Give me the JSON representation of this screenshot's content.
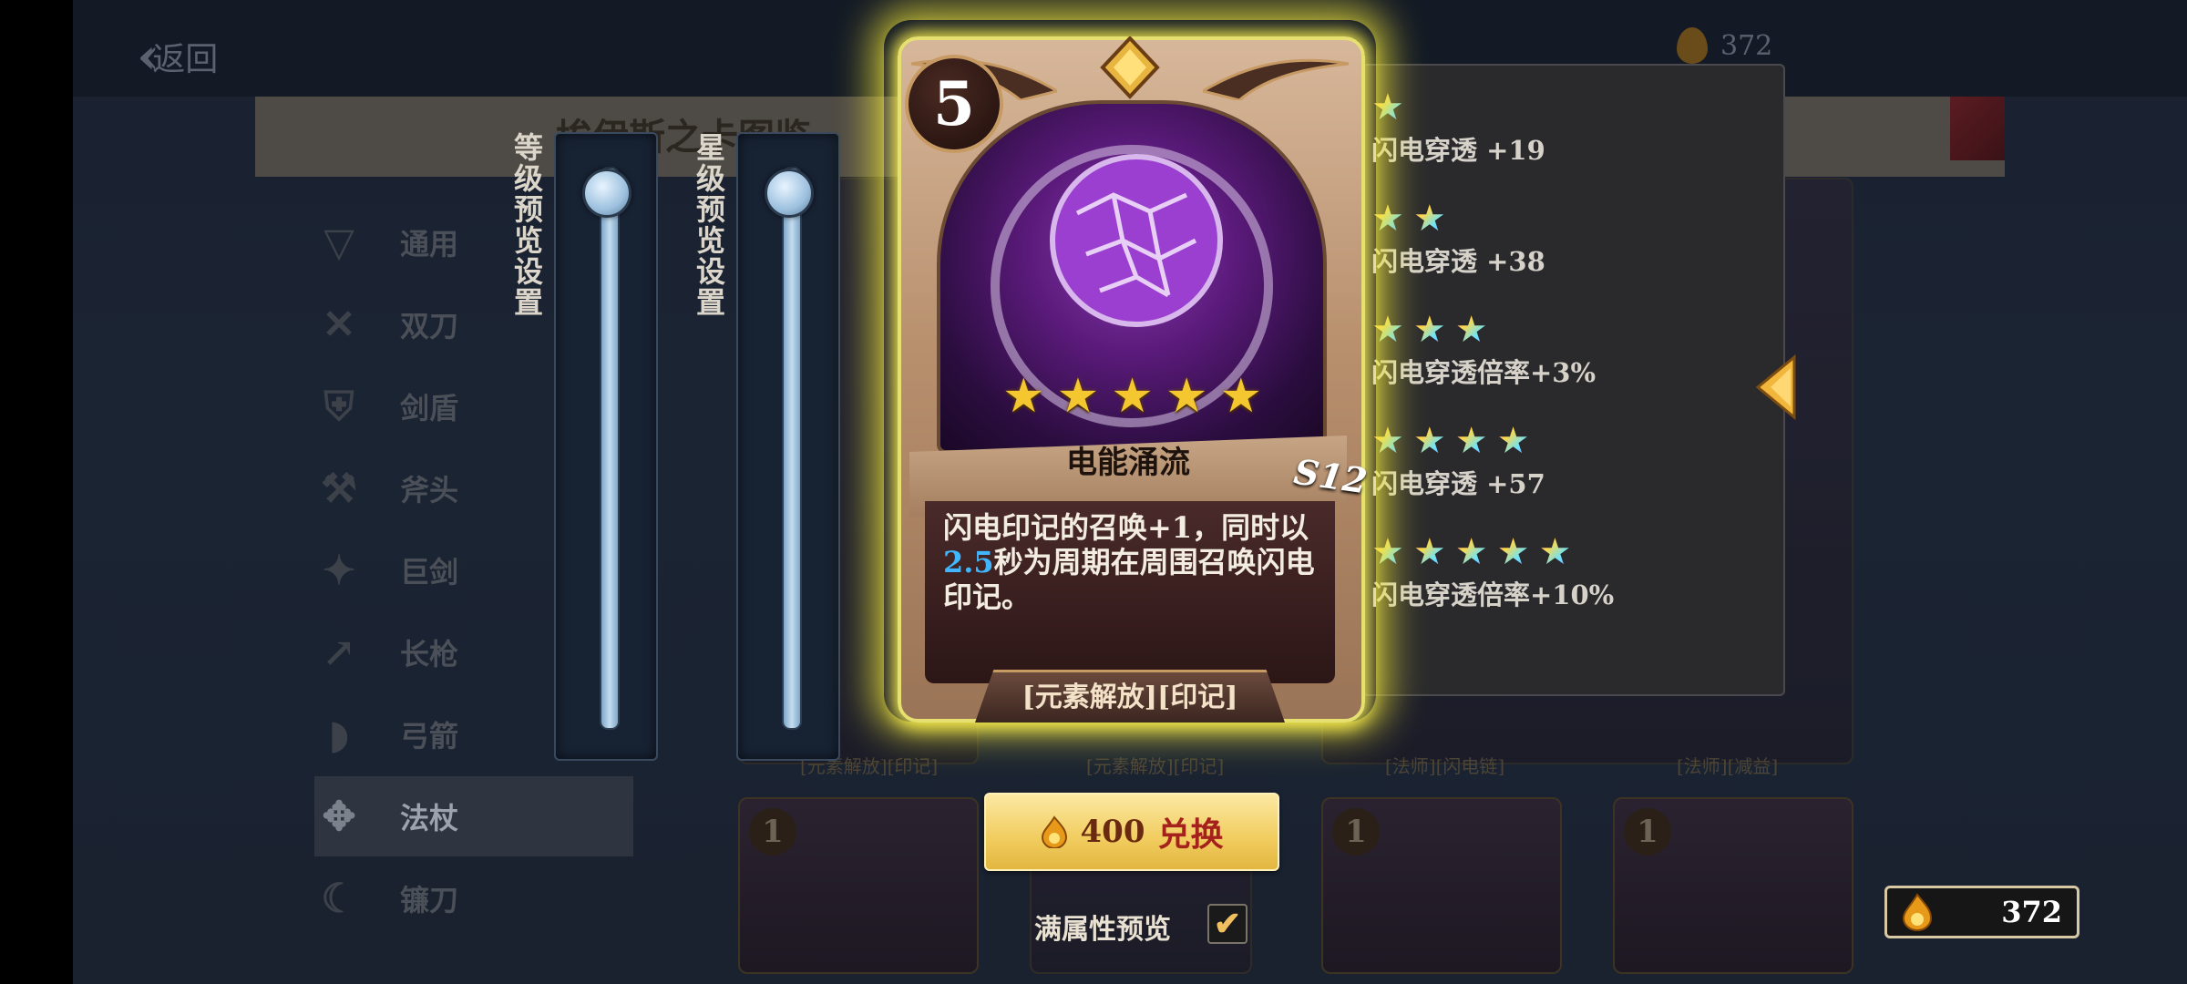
{
  "background": {
    "back_label": "返回",
    "top_currency": "372",
    "title": "埃伊斯之卡图鉴",
    "categories": [
      {
        "label": "通用",
        "icon": "universal-icon",
        "active": false
      },
      {
        "label": "双刀",
        "icon": "dual-blades-icon",
        "active": false
      },
      {
        "label": "剑盾",
        "icon": "sword-shield-icon",
        "active": false
      },
      {
        "label": "斧头",
        "icon": "axe-icon",
        "active": false
      },
      {
        "label": "巨剑",
        "icon": "greatsword-icon",
        "active": false
      },
      {
        "label": "长枪",
        "icon": "spear-icon",
        "active": false
      },
      {
        "label": "弓箭",
        "icon": "bow-icon",
        "active": false
      },
      {
        "label": "法杖",
        "icon": "staff-icon",
        "active": true
      },
      {
        "label": "镰刀",
        "icon": "scythe-icon",
        "active": false
      }
    ],
    "grid_tags": [
      "[元素解放][印记]",
      "[元素解放][印记]",
      "[法师][闪电链]",
      "[法师][减益]"
    ],
    "grid_card_levels": [
      "1",
      "1",
      "1",
      "1"
    ]
  },
  "sliders": {
    "level_label": "等级预览设置",
    "star_label": "星级预览设置"
  },
  "card": {
    "level": "5",
    "stars": 5,
    "name": "电能涌流",
    "desc_pre": "闪电印记的召唤+1，同时以",
    "desc_highlight": "2.5",
    "desc_post": "秒为周期在周围召唤闪电印记。",
    "tag": "[元素解放][印记]",
    "code": "S12",
    "glow_color": "#f0e63c",
    "highlight_color": "#3fb6ff"
  },
  "star_tiers": [
    {
      "stars": 1,
      "text": "闪电穿透 +19"
    },
    {
      "stars": 2,
      "text": "闪电穿透 +38"
    },
    {
      "stars": 3,
      "text": "闪电穿透倍率+3%"
    },
    {
      "stars": 4,
      "text": "闪电穿透 +57"
    },
    {
      "stars": 5,
      "text": "闪电穿透倍率+10%"
    }
  ],
  "exchange": {
    "price": "400",
    "label": "兑换"
  },
  "full_preview": {
    "label": "满属性预览",
    "checked": true,
    "check_glyph": "✔"
  },
  "currency": {
    "value": "372",
    "icon": "soul-flame-icon"
  }
}
